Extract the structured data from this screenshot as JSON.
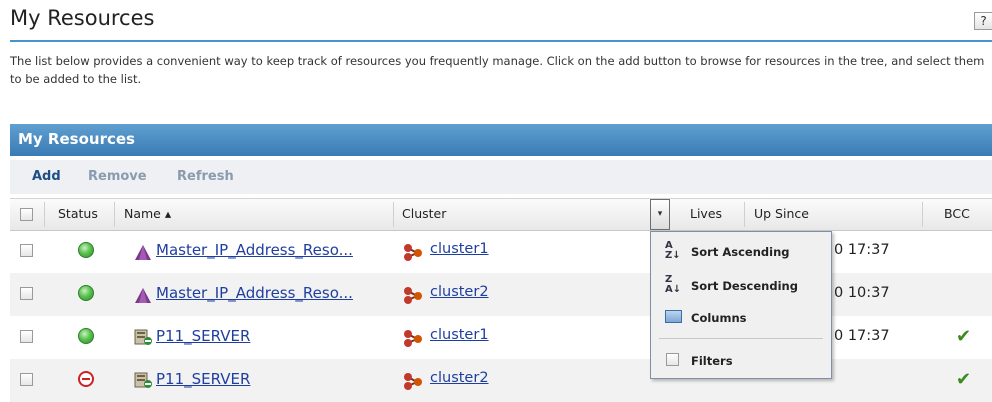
{
  "page": {
    "title": "My Resources",
    "help_label": "?",
    "intro": "The list below provides a convenient way to keep track of resources you frequently manage. Click on the add button to browse for resources in the tree, and select them to be added to the list."
  },
  "panel": {
    "title": "My Resources",
    "toolbar": {
      "add": "Add",
      "remove": "Remove",
      "refresh": "Refresh"
    }
  },
  "table": {
    "columns": {
      "status": "Status",
      "name": "Name ▴",
      "cluster": "Cluster",
      "lives": "Lives",
      "up_since": "Up Since",
      "bcc": "BCC"
    },
    "column_menu_button": "▾",
    "rows": [
      {
        "status": "up",
        "name": "Master_IP_Address_Reso...",
        "name_icon": "ip-resource-icon",
        "cluster": "cluster1",
        "up_since": "0 17:37",
        "bcc": ""
      },
      {
        "status": "up",
        "name": "Master_IP_Address_Reso...",
        "name_icon": "ip-resource-icon",
        "cluster": "cluster2",
        "up_since": "0 10:37",
        "bcc": ""
      },
      {
        "status": "up",
        "name": "P11_SERVER",
        "name_icon": "server-icon",
        "cluster": "cluster1",
        "up_since": "0 17:37",
        "bcc": "✔"
      },
      {
        "status": "down",
        "name": "P11_SERVER",
        "name_icon": "server-icon",
        "cluster": "cluster2",
        "up_since": "",
        "bcc": "✔"
      }
    ]
  },
  "column_menu": {
    "sort_ascending": "Sort Ascending",
    "sort_descending": "Sort Descending",
    "columns": "Columns",
    "filters": "Filters"
  },
  "colors": {
    "header_blue": "#3a7bb5",
    "link": "#1f3fa0",
    "status_up": "#5bc24f",
    "status_down": "#cc2222",
    "check_green": "#3a8a1e"
  }
}
